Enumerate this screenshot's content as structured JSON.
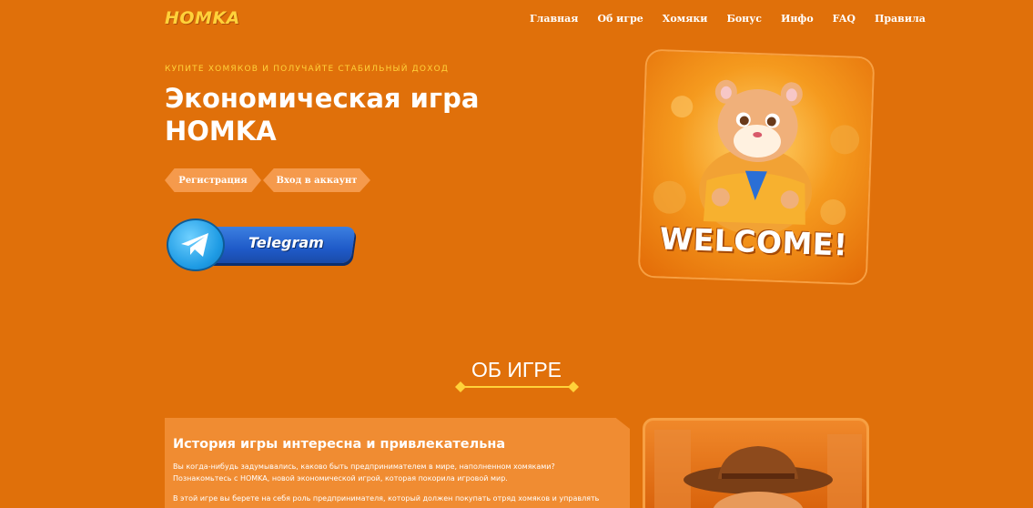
{
  "brand": {
    "logo": "HOMKA"
  },
  "nav": {
    "items": [
      "Главная",
      "Об игре",
      "Хомяки",
      "Бонус",
      "Инфо",
      "FAQ",
      "Правила"
    ]
  },
  "hero": {
    "kicker": "КУПИТЕ ХОМЯКОВ И ПОЛУЧАЙТЕ СТАБИЛЬНЫЙ ДОХОД",
    "title_line1": "Экономическая игра",
    "title_line2": "HOMKA",
    "register_label": "Регистрация",
    "login_label": "Вход в аккаунт",
    "telegram_label": "Telegram",
    "welcome_text": "WELCOME!"
  },
  "about": {
    "section_title": "ОБ ИГРЕ",
    "card_title": "История игры интересна и привлекательна",
    "paragraph1": "Вы когда-нибудь задумывались, каково быть предпринимателем в мире, наполненном хомяками? Познакомьтесь с HOMKA, новой экономической игрой, которая покорила игровой мир.",
    "paragraph2": "В этой игре вы берете на себя роль предпринимателя, который должен покупать отряд хомяков и управлять им,"
  },
  "colors": {
    "background": "#e0700a",
    "accent_yellow": "#ffd23a",
    "pill": "#f59a4c",
    "telegram_blue": "#1f5bc9"
  }
}
